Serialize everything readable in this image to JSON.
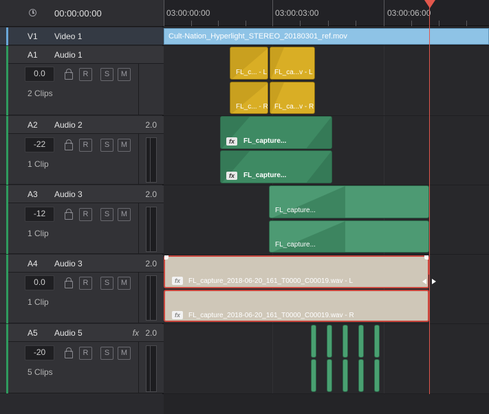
{
  "header": {
    "timecode": "00:00:00:00"
  },
  "ruler": {
    "marks": [
      "03:00:00:00",
      "03:00:03:00",
      "03:00:06:00"
    ]
  },
  "tracks": [
    {
      "id": "V1",
      "name": "Video 1"
    },
    {
      "id": "A1",
      "name": "Audio 1",
      "volume": "0.0",
      "clips": "2 Clips",
      "buttons": [
        "R",
        "S",
        "M"
      ]
    },
    {
      "id": "A2",
      "name": "Audio 2",
      "channels": "2.0",
      "volume": "-22",
      "clips": "1 Clip",
      "buttons": [
        "R",
        "S",
        "M"
      ]
    },
    {
      "id": "A3",
      "name": "Audio 3",
      "channels": "2.0",
      "volume": "-12",
      "clips": "1 Clip",
      "buttons": [
        "R",
        "S",
        "M"
      ]
    },
    {
      "id": "A4",
      "name": "Audio 3",
      "channels": "2.0",
      "volume": "0.0",
      "clips": "1 Clip",
      "buttons": [
        "R",
        "S",
        "M"
      ]
    },
    {
      "id": "A5",
      "name": "Audio 5",
      "fx": "fx",
      "channels": "2.0",
      "volume": "-20",
      "clips": "5 Clips",
      "buttons": [
        "R",
        "S",
        "M"
      ]
    }
  ],
  "clips": {
    "video": "Cult-Nation_Hyperlight_STEREO_20180301_ref.mov",
    "a1": [
      "FL_c... - L",
      "FL_ca...v - L",
      "FL_c... - R",
      "FL_ca...v - R"
    ],
    "a2": [
      "FL_capture...",
      "FL_capture..."
    ],
    "a3": [
      "FL_capture...",
      "FL_capture..."
    ],
    "a4": [
      "FL_capture_2018-06-20_161_T0000_C00019.wav - L",
      "FL_capture_2018-06-20_161_T0000_C00019.wav - R"
    ],
    "fx_badge": "fx"
  },
  "colors": {
    "audio_accent": "#2f9a5e",
    "video_accent": "#8ec3e6",
    "playhead": "#e2574c",
    "selection": "#c9463d"
  }
}
